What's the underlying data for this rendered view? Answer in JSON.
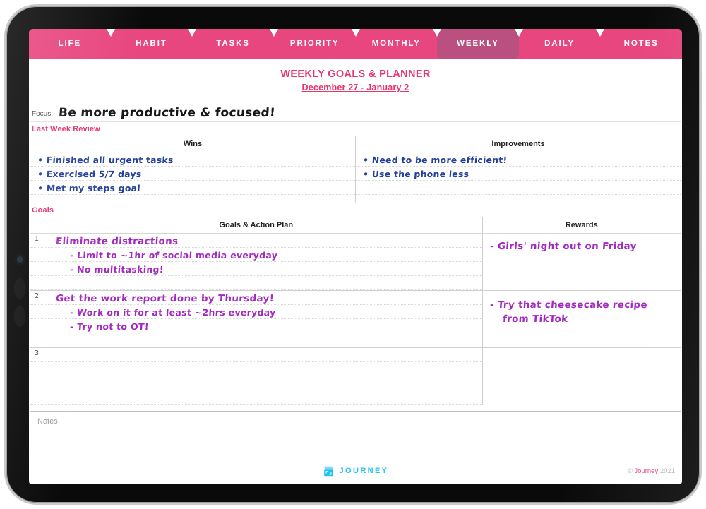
{
  "tabs": [
    {
      "label": "LIFE",
      "active": false
    },
    {
      "label": "HABIT",
      "active": false
    },
    {
      "label": "TASKS",
      "active": false
    },
    {
      "label": "PRIORITY",
      "active": false
    },
    {
      "label": "MONTHLY",
      "active": false
    },
    {
      "label": "WEEKLY",
      "active": true
    },
    {
      "label": "DAILY",
      "active": false
    },
    {
      "label": "NOTES",
      "active": false
    }
  ],
  "header": {
    "title": "WEEKLY GOALS & PLANNER",
    "date_range": "December 27 - January 2"
  },
  "focus": {
    "label": "Focus:",
    "value": "Be more productive & focused!"
  },
  "last_week_review": {
    "section_label": "Last Week Review",
    "columns": [
      "Wins",
      "Improvements"
    ],
    "wins": [
      "• Finished all urgent tasks",
      "• Exercised 5/7 days",
      "• Met my steps goal"
    ],
    "improvements": [
      "• Need to be more efficient!",
      "• Use the phone less"
    ]
  },
  "goals": {
    "section_label": "Goals",
    "columns": [
      "Goals & Action Plan",
      "Rewards"
    ],
    "rows": [
      {
        "number": "1",
        "title": "Eliminate distractions",
        "actions": [
          "- Limit to ~1hr of social media everyday",
          "- No multitasking!"
        ],
        "reward": [
          "- Girls' night out on  Friday"
        ]
      },
      {
        "number": "2",
        "title": "Get the work report done by Thursday!",
        "actions": [
          "- Work on it for at least ~2hrs everyday",
          "- Try not to OT!"
        ],
        "reward": [
          "- Try that cheesecake recipe",
          "from TikTok"
        ]
      },
      {
        "number": "3",
        "title": "",
        "actions": [
          "",
          ""
        ],
        "reward": [
          ""
        ]
      }
    ]
  },
  "notes": {
    "label": "Notes",
    "value": ""
  },
  "footer": {
    "brand": "JOURNEY",
    "copyright_prefix": "©",
    "copyright_brand": "Journey",
    "copyright_year": "2021"
  },
  "colors": {
    "tab_pink": "#e8467f",
    "tab_active": "#b9507f",
    "title_pink": "#e8336b",
    "ink_blue": "#24409a",
    "ink_purple": "#a32ac0",
    "brand_cyan": "#25c3ee"
  }
}
